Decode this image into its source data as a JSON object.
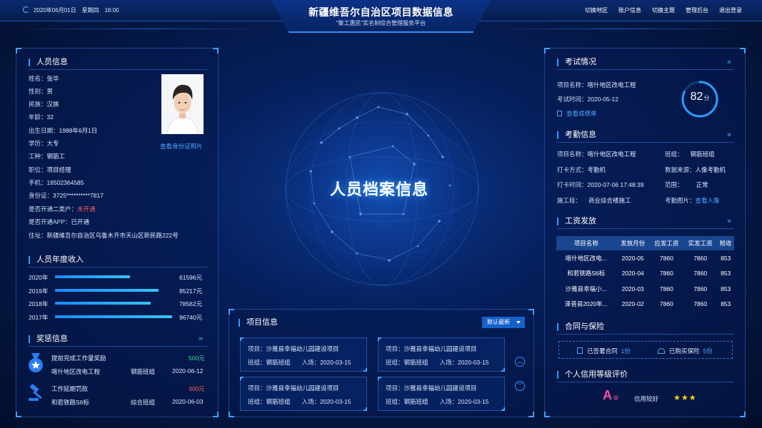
{
  "header": {
    "title": "新疆维吾尔自治区项目数据信息",
    "subtitle": "“聚工惠民”实名制综合管理服务平台",
    "date": "2020年06月01日",
    "weekday": "星期四",
    "time": "16:00",
    "nav": [
      "切换地区",
      "账户信息",
      "切换主题",
      "管理后台",
      "退出登录"
    ]
  },
  "person": {
    "section_title": "人员信息",
    "fields": [
      {
        "label": "姓名：",
        "value": "张华"
      },
      {
        "label": "性别：",
        "value": "男"
      },
      {
        "label": "民族：",
        "value": "汉族"
      },
      {
        "label": "年龄：",
        "value": "32"
      },
      {
        "label": "出生日期：",
        "value": "1988年6月1日"
      },
      {
        "label": "学历：",
        "value": "大专"
      },
      {
        "label": "工种：",
        "value": "钢筋工"
      },
      {
        "label": "职位：",
        "value": "项目经理"
      },
      {
        "label": "手机：",
        "value": "18502364585"
      },
      {
        "label": "身份证：",
        "value": "3725**********7817"
      },
      {
        "label": "是否开通二类户：",
        "value": "未开通"
      },
      {
        "label": "是否开通APP：",
        "value": "已开通"
      },
      {
        "label": "住址：",
        "value": "新疆维吾尔自治区乌鲁木齐市天山区新民路222号"
      }
    ],
    "id_photo_link": "查看身份证照片"
  },
  "income": {
    "section_title": "人员年度收入",
    "rows": [
      {
        "year": "2020年",
        "amount": "61596元",
        "value": 61596
      },
      {
        "year": "2019年",
        "amount": "85217元",
        "value": 85217
      },
      {
        "year": "2018年",
        "amount": "78562元",
        "value": 78562
      },
      {
        "year": "2017年",
        "amount": "96740元",
        "value": 96740
      }
    ],
    "max": 100000
  },
  "rewards": {
    "section_title": "奖惩信息",
    "items": [
      {
        "title": "提前完成工作量奖励",
        "amount": "500元",
        "project": "喀什地区改电工程",
        "team": "钢筋班组",
        "date": "2020-06-12",
        "type": "reward"
      },
      {
        "title": "工作延期罚款",
        "amount": "300元",
        "project": "和若铁路S6标",
        "team": "综合班组",
        "date": "2020-06-03",
        "type": "penalty"
      }
    ]
  },
  "center": {
    "title": "人员档案信息"
  },
  "projects": {
    "section_title": "项目信息",
    "sort_label": "默认最新",
    "cards": [
      {
        "project_label": "项目：",
        "project": "沙雅县幸福幼儿园建设项目",
        "team_label": "班组：",
        "team": "钢筋班组",
        "entry_label": "入场：",
        "entry": "2020-03-15"
      },
      {
        "project_label": "项目：",
        "project": "沙雅县幸福幼儿园建设项目",
        "team_label": "班组：",
        "team": "钢筋班组",
        "entry_label": "入场：",
        "entry": "2020-03-15"
      },
      {
        "project_label": "项目：",
        "project": "沙雅县幸福幼儿园建设项目",
        "team_label": "班组：",
        "team": "钢筋班组",
        "entry_label": "入场：",
        "entry": "2020-03-15"
      },
      {
        "project_label": "项目：",
        "project": "沙雅县幸福幼儿园建设项目",
        "team_label": "班组：",
        "team": "钢筋班组",
        "entry_label": "入场：",
        "entry": "2020-03-15"
      }
    ]
  },
  "exam": {
    "section_title": "考试情况",
    "project_label": "项目名称：",
    "project": "喀什地区改电工程",
    "time_label": "考试时间：",
    "time": "2020-05-12",
    "result_link": "查看成绩单",
    "score": "82",
    "score_unit": "分",
    "score_value": 82
  },
  "attendance": {
    "section_title": "考勤信息",
    "project_label": "项目名称：",
    "project": "喀什地区改电工程",
    "team_label": "班组：",
    "team": "钢筋班组",
    "method_label": "打卡方式：",
    "method": "考勤机",
    "source_label": "数据来源：",
    "source": "人像考勤机",
    "time_label": "打卡时间：",
    "time": "2020-07-06 17:48:39",
    "range_label": "范围：",
    "range": "正常",
    "section_label": "施工段：",
    "section": "商业综合楼施工",
    "photo_label": "考勤图片：",
    "photo_link": "查看人像"
  },
  "wages": {
    "section_title": "工资发放",
    "headers": [
      "项目名称",
      "发放月份",
      "应发工资",
      "实发工资",
      "税收"
    ],
    "rows": [
      [
        "喀什地区改电...",
        "2020-05",
        "7860",
        "7860",
        "853"
      ],
      [
        "和若铁路S6标",
        "2020-04",
        "7860",
        "7860",
        "853"
      ],
      [
        "沙雅县幸福小...",
        "2020-03",
        "7860",
        "7860",
        "853"
      ],
      [
        "泽普县2020年...",
        "2020-02",
        "7860",
        "7860",
        "853"
      ]
    ]
  },
  "contract": {
    "section_title": "合同与保险",
    "signed_label": "已签署合同",
    "signed_count": "1份",
    "insured_label": "已购买保险",
    "insured_count": "5份"
  },
  "credit": {
    "section_title": "个人信用等级评价",
    "grade": "A",
    "grade_suffix": "级",
    "desc": "信用较好",
    "stars": 3
  },
  "colors": {
    "accent": "#2f9bff",
    "red": "#ff5a5a",
    "green": "#3fd98a",
    "grade": "#ff4fa0",
    "star": "#ffd21e"
  }
}
